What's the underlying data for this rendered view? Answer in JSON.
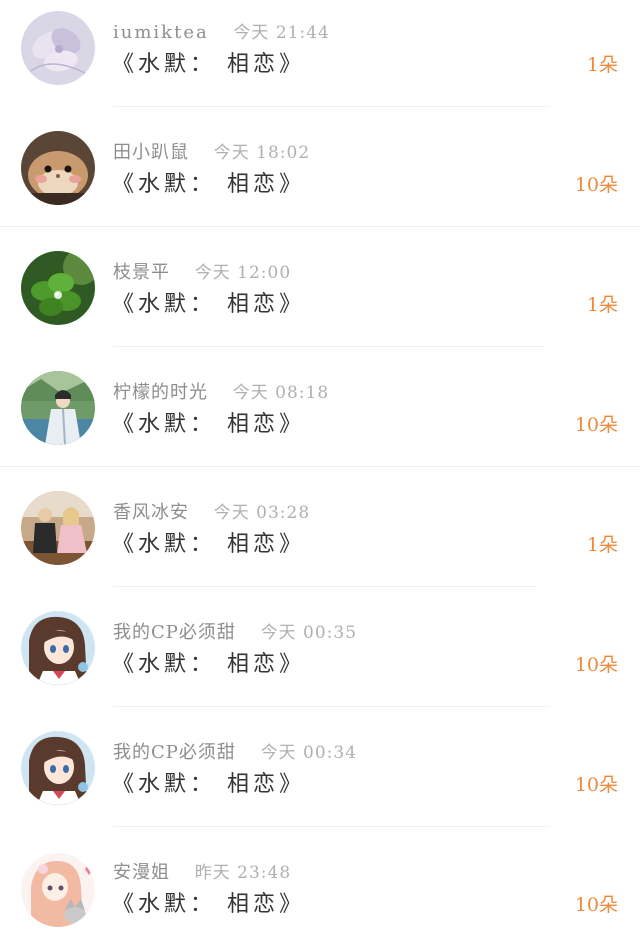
{
  "accent_color": "#f08a3c",
  "items": [
    {
      "name": "iumiktea",
      "time": "今天 21:44",
      "message": "《水默： 相恋》",
      "count": "1朵",
      "avatar_icon": "flower-avatar-icon"
    },
    {
      "name": "田小趴鼠",
      "time": "今天 18:02",
      "message": "《水默： 相恋》",
      "count": "10朵",
      "avatar_icon": "hamster-avatar-icon"
    },
    {
      "name": "枝景平",
      "time": "今天 12:00",
      "message": "《水默： 相恋》",
      "count": "1朵",
      "avatar_icon": "clover-avatar-icon"
    },
    {
      "name": "柠檬的时光",
      "time": "今天 08:18",
      "message": "《水默： 相恋》",
      "count": "10朵",
      "avatar_icon": "costume-figure-avatar-icon"
    },
    {
      "name": "香风冰安",
      "time": "今天 03:28",
      "message": "《水默： 相恋》",
      "count": "1朵",
      "avatar_icon": "couple-avatar-icon"
    },
    {
      "name": "我的CP必须甜",
      "time": "今天 00:35",
      "message": "《水默： 相恋》",
      "count": "10朵",
      "avatar_icon": "anime-girl-avatar-icon"
    },
    {
      "name": "我的CP必须甜",
      "time": "今天 00:34",
      "message": "《水默： 相恋》",
      "count": "10朵",
      "avatar_icon": "anime-girl-avatar-icon"
    },
    {
      "name": "安漫姐",
      "time": "昨天 23:48",
      "message": "《水默： 相恋》",
      "count": "10朵",
      "avatar_icon": "anime-girl-cat-avatar-icon"
    }
  ]
}
